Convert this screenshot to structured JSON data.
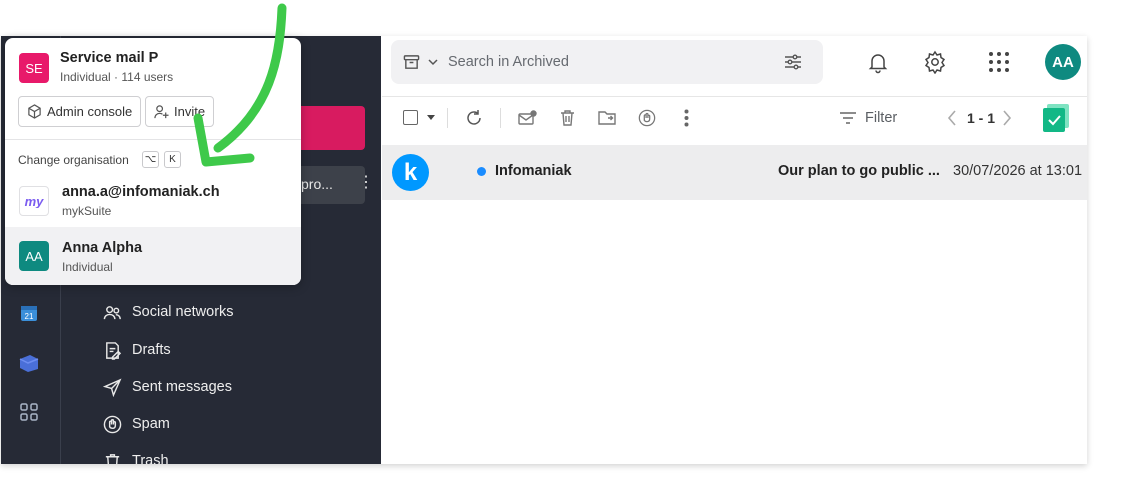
{
  "org_popover": {
    "avatar_initials": "SE",
    "org_name": "Service mail P",
    "org_subtitle": "Individual · 114 users",
    "admin_console_label": "Admin console",
    "invite_label": "Invite",
    "change_org_label": "Change organisation",
    "shortcut_keys": [
      "⌥",
      "K"
    ],
    "accounts": [
      {
        "icon": "myk",
        "title": "anna.a@infomaniak.ch",
        "subtitle": "mykSuite"
      },
      {
        "icon": "AA",
        "title": "Anna Alpha",
        "subtitle": "Individual"
      }
    ]
  },
  "nav": {
    "hovered_folder_text": "pro...",
    "items": [
      {
        "label": "Social networks",
        "icon": "people-icon"
      },
      {
        "label": "Drafts",
        "icon": "drafts-icon"
      },
      {
        "label": "Sent messages",
        "icon": "send-icon"
      },
      {
        "label": "Spam",
        "icon": "spam-icon"
      },
      {
        "label": "Trash",
        "icon": "trash-icon"
      }
    ]
  },
  "rail": {
    "calendar_badge": "21"
  },
  "search": {
    "placeholder": "Search in Archived"
  },
  "header": {
    "avatar_initials": "AA"
  },
  "toolbar": {
    "filter_label": "Filter",
    "pager_label": "1 - 1"
  },
  "mail_list": [
    {
      "sender": "Infomaniak",
      "subject": "Our plan to go public ...",
      "date": "30/07/2026 at 13:01",
      "unread": true,
      "logo_letter": "k"
    }
  ],
  "colors": {
    "sidebar_bg": "#262a36",
    "primary_pink": "#d81b60",
    "avatar_teal": "#0e8a80",
    "annotation_arrow": "#3ec94a",
    "unread_dot": "#1a8cff"
  }
}
